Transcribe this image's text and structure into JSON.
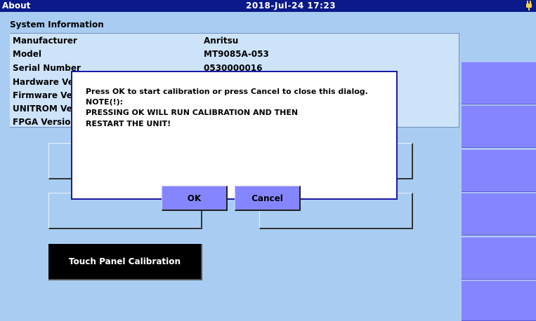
{
  "titlebar": {
    "title": "About",
    "datetime": "2018-Jul-24 17:23",
    "power_icon": "plug-icon"
  },
  "system_info": {
    "header": "System Information",
    "rows": [
      {
        "label": "Manufacturer",
        "value": "Anritsu"
      },
      {
        "label": "Model",
        "value": "MT9085A-053"
      },
      {
        "label": "Serial Number",
        "value": "0530000016"
      },
      {
        "label": "Hardware Ver",
        "value": ""
      },
      {
        "label": "Firmware Ver",
        "value": ""
      },
      {
        "label": "UNITROM Ver",
        "value": ""
      },
      {
        "label": "FPGA Version",
        "value": ""
      }
    ]
  },
  "buttons": {
    "touch_panel_calibration": "Touch Panel Calibration"
  },
  "dialog": {
    "line1": "Press OK to start calibration or press Cancel to close this dialog.",
    "line2": "NOTE(!):",
    "line3": "PRESSING OK WILL RUN CALIBRATION AND THEN",
    "line4": "RESTART THE UNIT!",
    "ok_label": "OK",
    "cancel_label": "Cancel"
  },
  "colors": {
    "titlebar": "#0a1a8a",
    "background": "#a9cdf2",
    "softkey": "#8585ff",
    "dialog_border": "#1a1aa6"
  }
}
